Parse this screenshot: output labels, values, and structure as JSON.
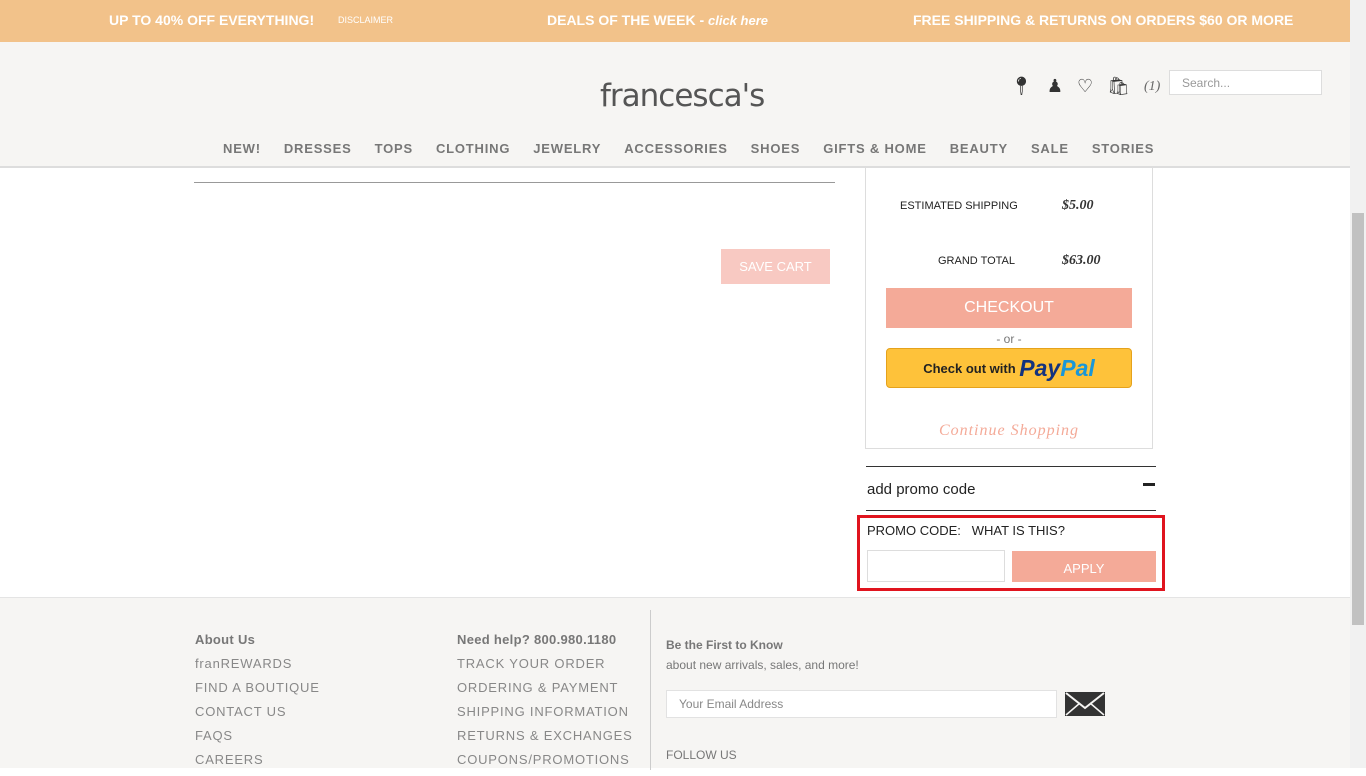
{
  "banner": {
    "left": "UP TO 40% OFF EVERYTHING!",
    "disclaimer": "DISCLAIMER",
    "middle": "DEALS OF THE WEEK - ",
    "middle_link": "click here",
    "right": "FREE SHIPPING & RETURNS ON ORDERS $60 OR MORE",
    "color": "#f2c28a"
  },
  "header": {
    "logo": "francesca's",
    "cart_count": "(1)",
    "search_placeholder": "Search...",
    "nav": [
      "NEW!",
      "DRESSES",
      "TOPS",
      "CLOTHING",
      "JEWELRY",
      "ACCESSORIES",
      "SHOES",
      "GIFTS & HOME",
      "BEAUTY",
      "SALE",
      "STORIES"
    ]
  },
  "cart": {
    "save_cart": "SAVE CART"
  },
  "summary": {
    "shipping_label": "ESTIMATED SHIPPING",
    "shipping_value": "$5.00",
    "total_label": "GRAND TOTAL",
    "total_value": "$63.00",
    "checkout": "CHECKOUT",
    "or": "- or -",
    "paypal_prefix": "Check out with",
    "paypal_pay": "Pay",
    "paypal_pal": "Pal",
    "continue": "Continue Shopping",
    "accent": "#f4aa98"
  },
  "promo": {
    "header": "add promo code",
    "label": "PROMO CODE:",
    "what": "WHAT IS THIS?",
    "input_value": "",
    "apply": "APPLY"
  },
  "footer": {
    "col1": [
      "About Us",
      "franREWARDS",
      "FIND A BOUTIQUE",
      "CONTACT US",
      "FAQS",
      "CAREERS"
    ],
    "col2": [
      "Need help? 800.980.1180",
      "TRACK YOUR ORDER",
      "ORDERING & PAYMENT",
      "SHIPPING INFORMATION",
      "RETURNS & EXCHANGES",
      "COUPONS/PROMOTIONS"
    ],
    "news_title": "Be the First to Know",
    "news_sub": "about new arrivals, sales, and more!",
    "email_placeholder": "Your Email Address",
    "follow": "FOLLOW US"
  }
}
